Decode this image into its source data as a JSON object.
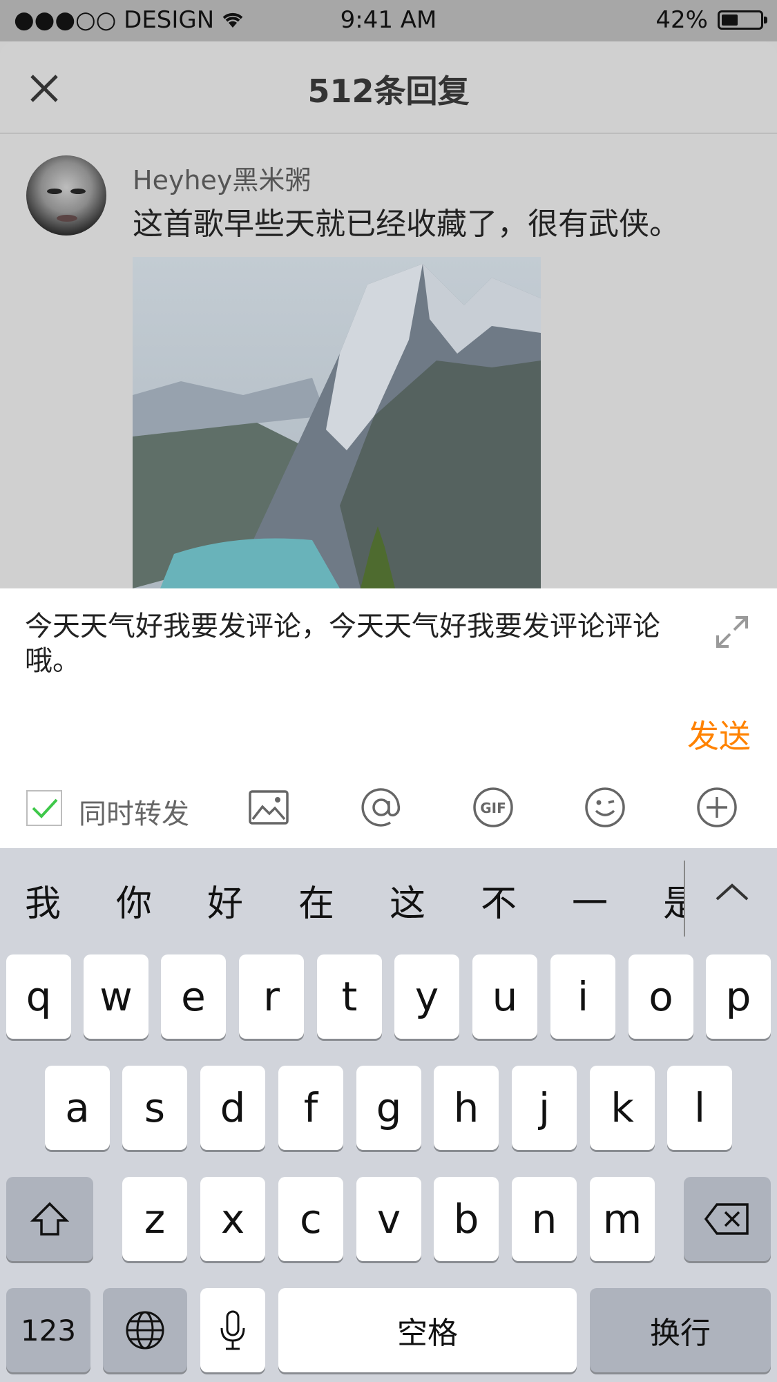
{
  "status_bar": {
    "carrier": "●●●○○ DESIGN",
    "time": "9:41 AM",
    "battery_percent": "42%",
    "battery_level": 0.42
  },
  "sheet": {
    "title": "512条回复"
  },
  "comment": {
    "username": "Heyhey黑米粥",
    "text": "这首歌早些天就已经收藏了，很有武侠。"
  },
  "composer": {
    "input_value": "今天天气好我要发评论，今天天气好我要发评论评论哦。",
    "send_label": "发送",
    "forward_label": "同时转发",
    "forward_checked": true,
    "accent_color": "#ff8200",
    "icons": [
      "image-icon",
      "at-icon",
      "gif-icon",
      "emoji-icon",
      "plus-icon"
    ]
  },
  "keyboard": {
    "candidates": [
      "我",
      "你",
      "好",
      "在",
      "这",
      "不",
      "一",
      "是"
    ],
    "rows": [
      [
        "q",
        "w",
        "e",
        "r",
        "t",
        "y",
        "u",
        "i",
        "o",
        "p"
      ],
      [
        "a",
        "s",
        "d",
        "f",
        "g",
        "h",
        "j",
        "k",
        "l"
      ],
      [
        "z",
        "x",
        "c",
        "v",
        "b",
        "n",
        "m"
      ]
    ],
    "numbers_label": "123",
    "space_label": "空格",
    "return_label": "换行"
  }
}
